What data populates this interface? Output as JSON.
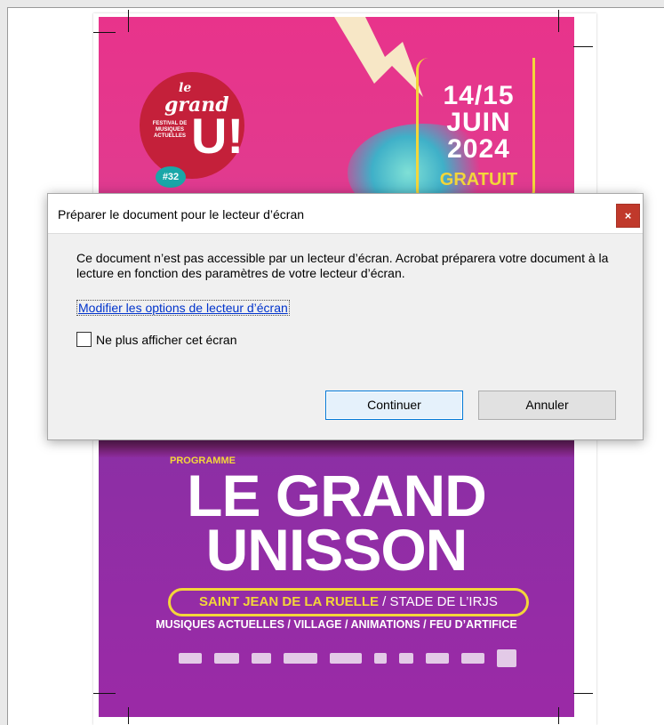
{
  "dialog": {
    "title": "Préparer le document pour le lecteur d’écran",
    "close_symbol": "×",
    "message": "Ce document n’est pas accessible par un lecteur d’écran. Acrobat préparera votre document à la lecture en fonction des paramètres de votre lecteur d’écran.",
    "link_label": "Modifier les options de lecteur d’écran",
    "checkbox_label": "Ne plus afficher cet écran",
    "checkbox_checked": false,
    "continue_label": "Continuer",
    "cancel_label": "Annuler"
  },
  "poster": {
    "logo_le": "le",
    "logo_grand": "grand",
    "logo_festival": "FESTIVAL DE MUSIQUES ACTUELLES",
    "logo_u": "U!",
    "logo_number": "#32",
    "date_line1": "14/15",
    "date_line2": "JUIN",
    "date_line3": "2024",
    "gratuit": "GRATUIT",
    "programme": "PROGRAMME",
    "title_line1": "LE GRAND",
    "title_line2": "UNISSON",
    "venue_bold": "SAINT JEAN DE LA RUELLE",
    "venue_rest": " / STADE DE L’IRJS",
    "tags": "MUSIQUES ACTUELLES / VILLAGE / ANIMATIONS / FEU D’ARTIFICE",
    "colors": {
      "pink": "#e8338b",
      "purple": "#9b2aa6",
      "yellow": "#f3d63a",
      "red": "#c4203a"
    }
  }
}
